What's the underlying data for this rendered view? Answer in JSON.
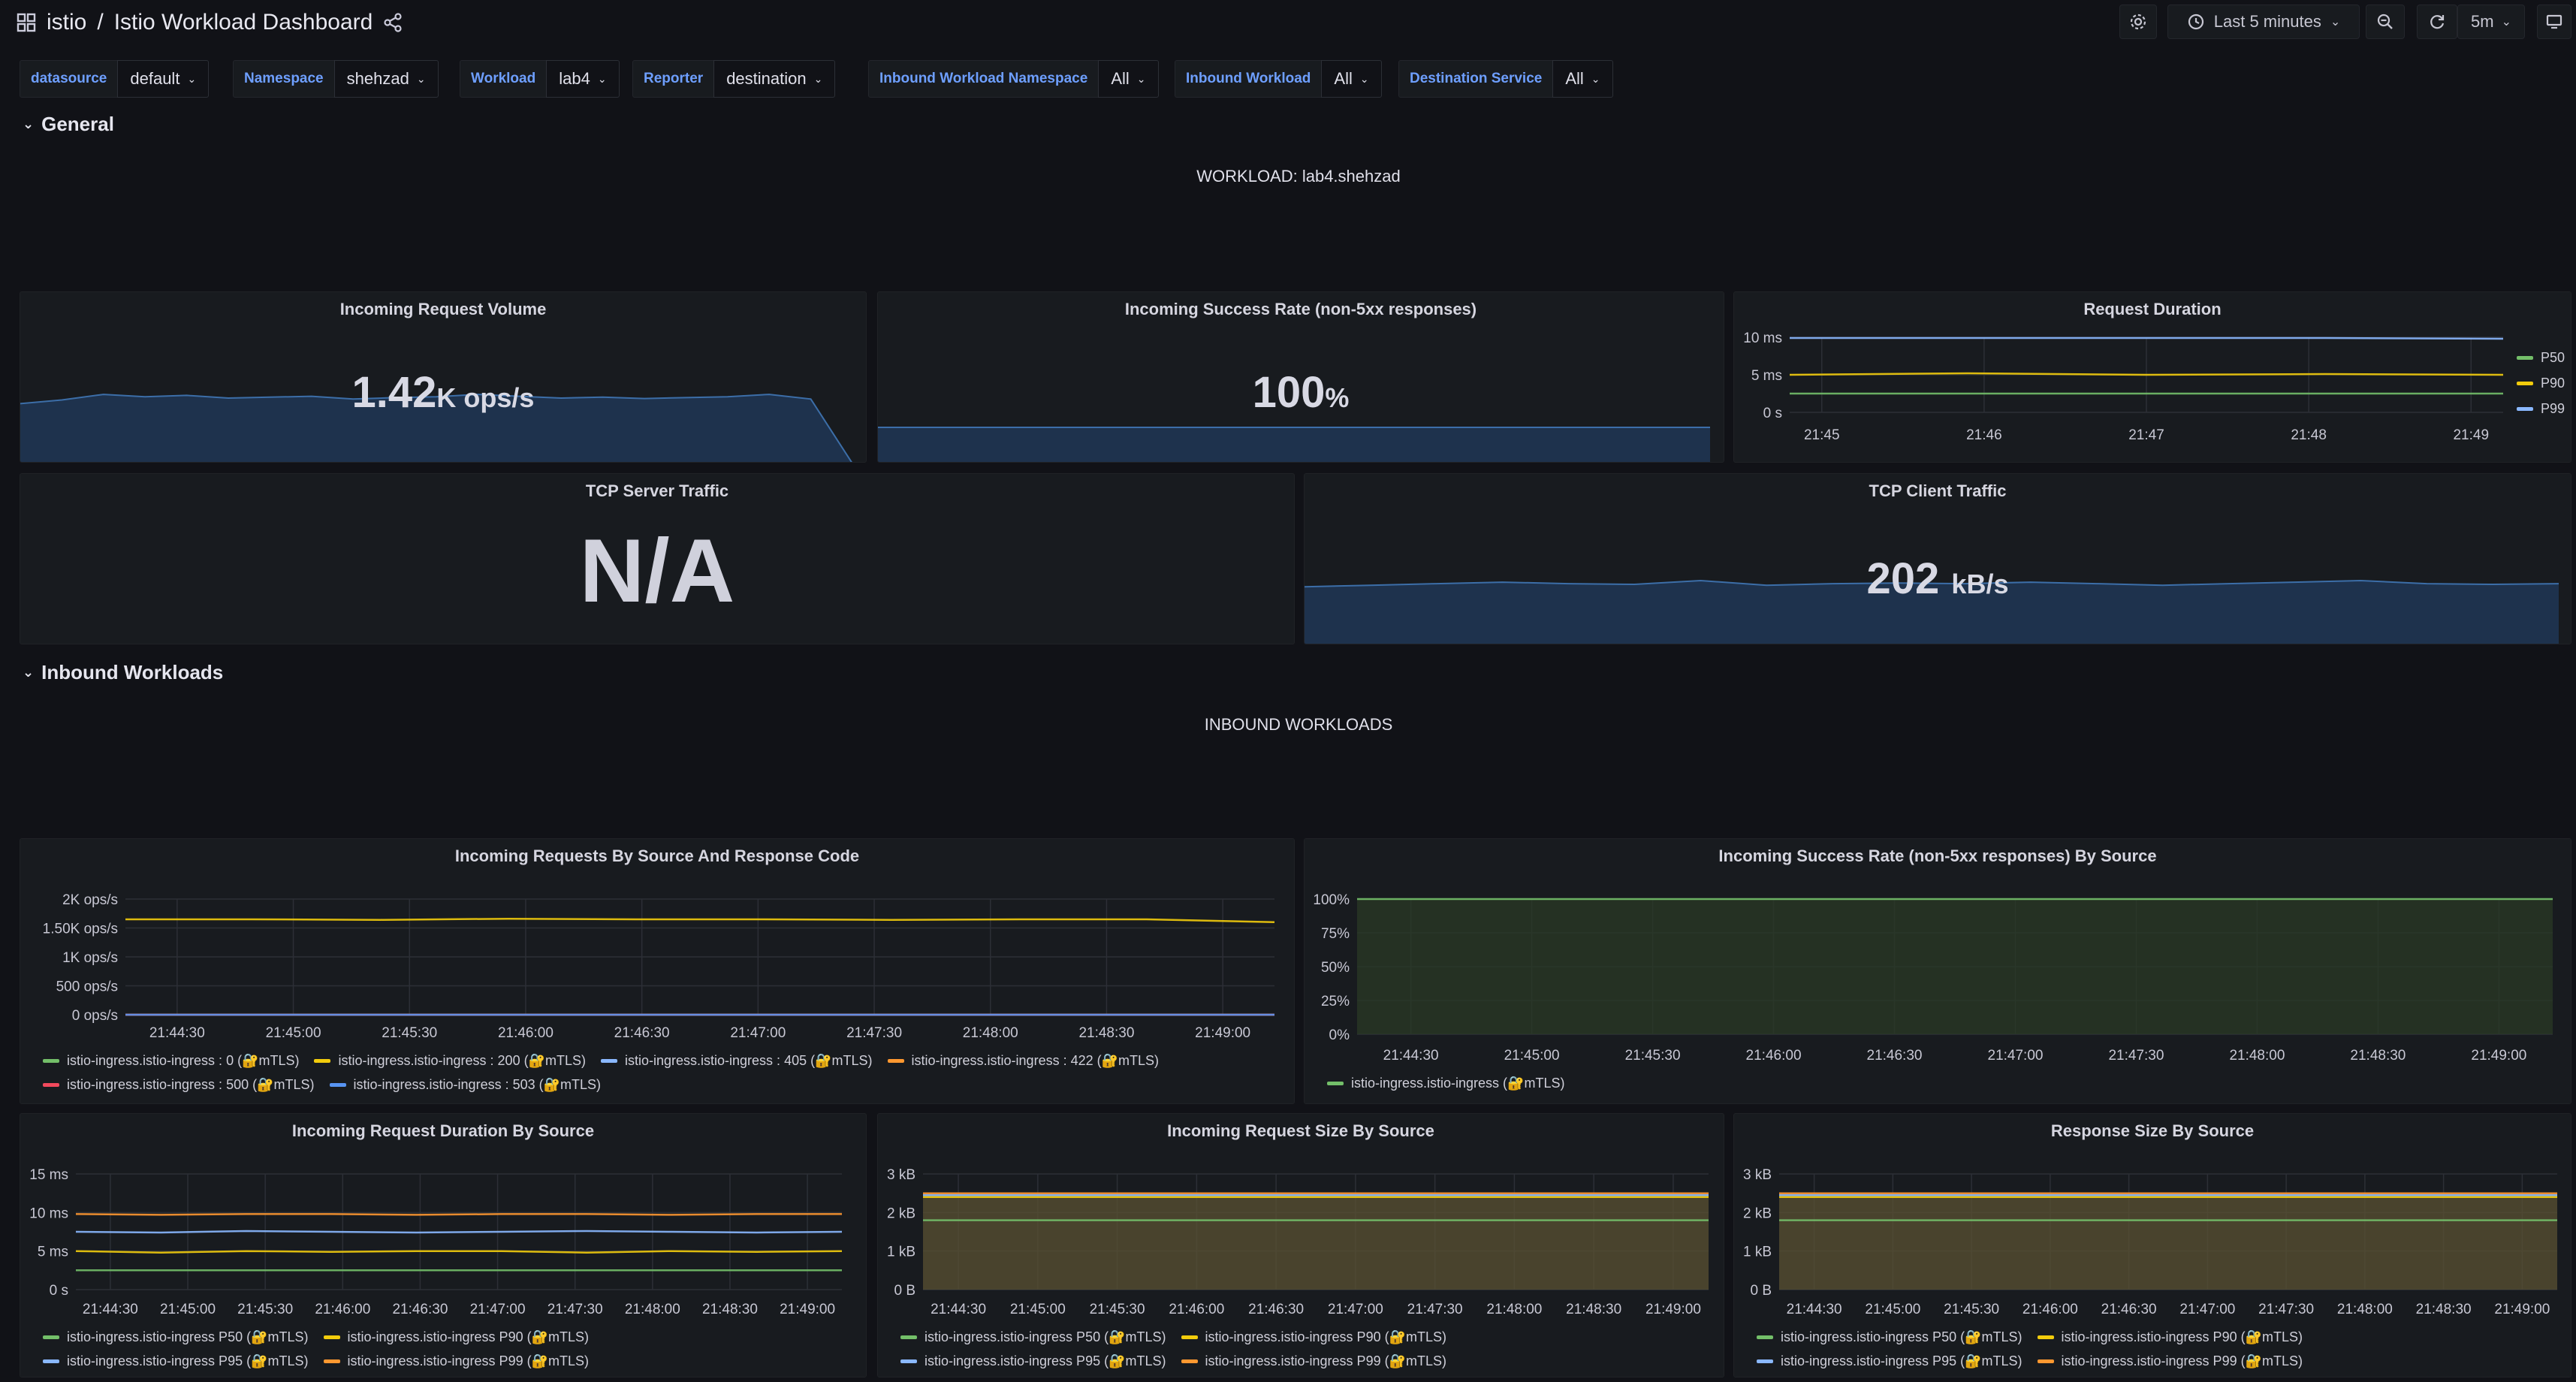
{
  "app": {
    "breadcrumb_folder": "istio",
    "breadcrumb_sep": "/",
    "dashboard_title": "Istio Workload Dashboard"
  },
  "toolbar": {
    "time_range": "Last 5 minutes",
    "refresh_interval": "5m"
  },
  "variables": [
    {
      "label": "datasource",
      "value": "default"
    },
    {
      "label": "Namespace",
      "value": "shehzad"
    },
    {
      "label": "Workload",
      "value": "lab4"
    },
    {
      "label": "Reporter",
      "value": "destination"
    },
    {
      "label": "Inbound Workload Namespace",
      "value": "All"
    },
    {
      "label": "Inbound Workload",
      "value": "All"
    },
    {
      "label": "Destination Service",
      "value": "All"
    }
  ],
  "rows": {
    "general": "General",
    "inbound": "Inbound Workloads"
  },
  "text_panels": {
    "workload": "WORKLOAD: lab4.shehzad",
    "inbound": "INBOUND WORKLOADS"
  },
  "colors": {
    "green": "#73bf69",
    "yellow": "#f2cc0c",
    "blue": "#8ab8ff",
    "orange": "#ff9830",
    "red": "#f2495c",
    "darkblue": "#5794f2"
  },
  "stat_panels": {
    "request_volume": {
      "title": "Incoming Request Volume",
      "value": "1.42",
      "unit": "K ops/s"
    },
    "success_rate": {
      "title": "Incoming Success Rate (non-5xx responses)",
      "value": "100",
      "unit": "%"
    },
    "tcp_server": {
      "title": "TCP Server Traffic",
      "value": "N/A"
    },
    "tcp_client": {
      "title": "TCP Client Traffic",
      "value": "202",
      "unit": "kB/s"
    }
  },
  "chart_data": [
    {
      "id": "request_duration",
      "type": "line",
      "title": "Request Duration",
      "x": [
        "21:45",
        "21:46",
        "21:47",
        "21:48",
        "21:49"
      ],
      "yticks": [
        "10 ms",
        "5 ms",
        "0 s"
      ],
      "ylim": [
        0,
        10
      ],
      "legend_position": "right",
      "series": [
        {
          "name": "P50",
          "values": [
            2.5,
            2.5,
            2.5,
            2.5,
            2.5
          ],
          "color": "#73bf69"
        },
        {
          "name": "P90",
          "values": [
            5,
            5.2,
            5,
            5.1,
            5
          ],
          "color": "#f2cc0c"
        },
        {
          "name": "P99",
          "values": [
            9.9,
            9.9,
            9.9,
            9.9,
            9.8
          ],
          "color": "#8ab8ff"
        }
      ]
    },
    {
      "id": "requests_by_source",
      "type": "line",
      "title": "Incoming Requests By Source And Response Code",
      "x": [
        "21:44:30",
        "21:45:00",
        "21:45:30",
        "21:46:00",
        "21:46:30",
        "21:47:00",
        "21:47:30",
        "21:48:00",
        "21:48:30",
        "21:49:00"
      ],
      "yticks": [
        "2K ops/s",
        "1.50K ops/s",
        "1K ops/s",
        "500 ops/s",
        "0 ops/s"
      ],
      "ylim": [
        0,
        2000
      ],
      "legend_position": "bottom",
      "series": [
        {
          "name": "istio-ingress.istio-ingress : 0 (🔐mTLS)",
          "values": [
            0,
            0,
            0,
            0,
            0,
            0,
            0,
            0,
            0,
            0
          ],
          "color": "#73bf69"
        },
        {
          "name": "istio-ingress.istio-ingress : 200 (🔐mTLS)",
          "values": [
            1650,
            1650,
            1640,
            1660,
            1650,
            1650,
            1640,
            1650,
            1650,
            1600
          ],
          "color": "#f2cc0c"
        },
        {
          "name": "istio-ingress.istio-ingress : 405 (🔐mTLS)",
          "values": [
            0,
            0,
            0,
            0,
            0,
            0,
            0,
            0,
            0,
            0
          ],
          "color": "#8ab8ff"
        },
        {
          "name": "istio-ingress.istio-ingress : 422 (🔐mTLS)",
          "values": [
            0,
            0,
            0,
            0,
            0,
            0,
            0,
            0,
            0,
            0
          ],
          "color": "#ff9830"
        },
        {
          "name": "istio-ingress.istio-ingress : 500 (🔐mTLS)",
          "values": [
            0,
            0,
            0,
            0,
            0,
            0,
            0,
            0,
            0,
            0
          ],
          "color": "#f2495c"
        },
        {
          "name": "istio-ingress.istio-ingress : 503 (🔐mTLS)",
          "values": [
            0,
            0,
            0,
            0,
            0,
            0,
            0,
            0,
            0,
            0
          ],
          "color": "#5794f2"
        }
      ]
    },
    {
      "id": "success_by_source",
      "type": "line",
      "title": "Incoming Success Rate (non-5xx responses) By Source",
      "x": [
        "21:44:30",
        "21:45:00",
        "21:45:30",
        "21:46:00",
        "21:46:30",
        "21:47:00",
        "21:47:30",
        "21:48:00",
        "21:48:30",
        "21:49:00"
      ],
      "yticks": [
        "100%",
        "75%",
        "50%",
        "25%",
        "0%"
      ],
      "ylim": [
        0,
        100
      ],
      "legend_position": "bottom",
      "series": [
        {
          "name": "istio-ingress.istio-ingress (🔐mTLS)",
          "values": [
            100,
            100,
            100,
            100,
            100,
            100,
            100,
            100,
            100,
            100
          ],
          "color": "#73bf69"
        }
      ]
    },
    {
      "id": "duration_by_source",
      "type": "line",
      "title": "Incoming Request Duration By Source",
      "x": [
        "21:44:30",
        "21:45:00",
        "21:45:30",
        "21:46:00",
        "21:46:30",
        "21:47:00",
        "21:47:30",
        "21:48:00",
        "21:48:30",
        "21:49:00"
      ],
      "yticks": [
        "15 ms",
        "10 ms",
        "5 ms",
        "0 s"
      ],
      "ylim": [
        0,
        15
      ],
      "legend_position": "bottom",
      "series": [
        {
          "name": "istio-ingress.istio-ingress P50 (🔐mTLS)",
          "values": [
            2.5,
            2.5,
            2.5,
            2.5,
            2.5,
            2.5,
            2.5,
            2.5,
            2.5,
            2.5
          ],
          "color": "#73bf69"
        },
        {
          "name": "istio-ingress.istio-ingress P90 (🔐mTLS)",
          "values": [
            5,
            4.8,
            5,
            4.9,
            5,
            5,
            4.8,
            5,
            4.9,
            5
          ],
          "color": "#f2cc0c"
        },
        {
          "name": "istio-ingress.istio-ingress P95 (🔐mTLS)",
          "values": [
            7.5,
            7.4,
            7.6,
            7.5,
            7.4,
            7.5,
            7.6,
            7.5,
            7.4,
            7.5
          ],
          "color": "#8ab8ff"
        },
        {
          "name": "istio-ingress.istio-ingress P99 (🔐mTLS)",
          "values": [
            9.8,
            9.7,
            9.8,
            9.8,
            9.7,
            9.8,
            9.8,
            9.7,
            9.8,
            9.8
          ],
          "color": "#ff9830"
        }
      ]
    },
    {
      "id": "req_size_by_source",
      "type": "area",
      "title": "Incoming Request Size By Source",
      "x": [
        "21:44:30",
        "21:45:00",
        "21:45:30",
        "21:46:00",
        "21:46:30",
        "21:47:00",
        "21:47:30",
        "21:48:00",
        "21:48:30",
        "21:49:00"
      ],
      "yticks": [
        "3 kB",
        "2 kB",
        "1 kB",
        "0 B"
      ],
      "ylim": [
        0,
        3
      ],
      "legend_position": "bottom",
      "series": [
        {
          "name": "istio-ingress.istio-ingress P50 (🔐mTLS)",
          "values": [
            1.8,
            1.8,
            1.8,
            1.8,
            1.8,
            1.8,
            1.8,
            1.8,
            1.8,
            1.8
          ],
          "color": "#73bf69"
        },
        {
          "name": "istio-ingress.istio-ingress P90 (🔐mTLS)",
          "values": [
            2.4,
            2.4,
            2.4,
            2.4,
            2.4,
            2.4,
            2.4,
            2.4,
            2.4,
            2.4
          ],
          "color": "#f2cc0c"
        },
        {
          "name": "istio-ingress.istio-ingress P95 (🔐mTLS)",
          "values": [
            2.45,
            2.45,
            2.45,
            2.45,
            2.45,
            2.45,
            2.45,
            2.45,
            2.45,
            2.45
          ],
          "color": "#8ab8ff"
        },
        {
          "name": "istio-ingress.istio-ingress P99 (🔐mTLS)",
          "values": [
            2.5,
            2.5,
            2.5,
            2.5,
            2.5,
            2.5,
            2.5,
            2.5,
            2.5,
            2.5
          ],
          "color": "#ff9830"
        }
      ]
    },
    {
      "id": "resp_size_by_source",
      "type": "area",
      "title": "Response Size By Source",
      "x": [
        "21:44:30",
        "21:45:00",
        "21:45:30",
        "21:46:00",
        "21:46:30",
        "21:47:00",
        "21:47:30",
        "21:48:00",
        "21:48:30",
        "21:49:00"
      ],
      "yticks": [
        "3 kB",
        "2 kB",
        "1 kB",
        "0 B"
      ],
      "ylim": [
        0,
        3
      ],
      "legend_position": "bottom",
      "series": [
        {
          "name": "istio-ingress.istio-ingress P50 (🔐mTLS)",
          "values": [
            1.8,
            1.8,
            1.8,
            1.8,
            1.8,
            1.8,
            1.8,
            1.8,
            1.8,
            1.8
          ],
          "color": "#73bf69"
        },
        {
          "name": "istio-ingress.istio-ingress P90 (🔐mTLS)",
          "values": [
            2.4,
            2.4,
            2.4,
            2.4,
            2.4,
            2.4,
            2.4,
            2.4,
            2.4,
            2.4
          ],
          "color": "#f2cc0c"
        },
        {
          "name": "istio-ingress.istio-ingress P95 (🔐mTLS)",
          "values": [
            2.45,
            2.45,
            2.45,
            2.45,
            2.45,
            2.45,
            2.45,
            2.45,
            2.45,
            2.45
          ],
          "color": "#8ab8ff"
        },
        {
          "name": "istio-ingress.istio-ingress P99 (🔐mTLS)",
          "values": [
            2.5,
            2.5,
            2.5,
            2.5,
            2.5,
            2.5,
            2.5,
            2.5,
            2.5,
            2.5
          ],
          "color": "#ff9830"
        }
      ]
    }
  ],
  "sparklines": {
    "request_volume": [
      1.3,
      1.38,
      1.5,
      1.45,
      1.48,
      1.42,
      1.44,
      1.46,
      1.4,
      1.43,
      1.45,
      1.5,
      1.46,
      1.42,
      1.44,
      1.41,
      1.43,
      1.45,
      1.5,
      1.4,
      0.0
    ],
    "success_rate": [
      100,
      100,
      100,
      100,
      100,
      100,
      100,
      100,
      100,
      100
    ],
    "tcp_client": [
      190,
      195,
      200,
      205,
      200,
      198,
      210,
      195,
      200,
      202,
      200,
      205,
      200,
      195,
      200,
      205,
      210,
      200,
      198,
      200
    ]
  }
}
